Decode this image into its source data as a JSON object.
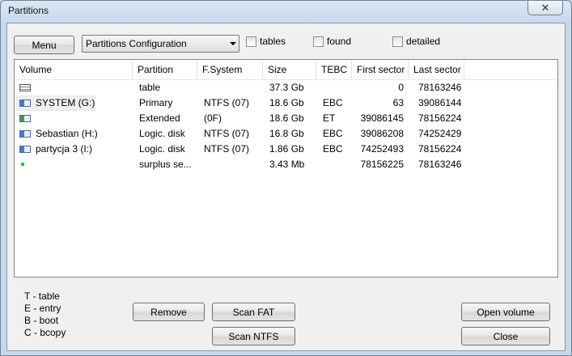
{
  "window": {
    "title": "Partitions",
    "close_glyph": "✕"
  },
  "toolbar": {
    "menu_label": "Menu",
    "view_select": "Partitions Configuration",
    "checkboxes": [
      {
        "label": "tables",
        "checked": false
      },
      {
        "label": "found",
        "checked": false
      },
      {
        "label": "detailed",
        "checked": false
      }
    ]
  },
  "table": {
    "columns": [
      "Volume",
      "Partition",
      "F.System",
      "Size",
      "TEBC",
      "First sector",
      "Last sector"
    ],
    "rows": [
      {
        "icon": "table-icon",
        "volume": "",
        "partition": "table",
        "fs": "",
        "size": "37.3 Gb",
        "tebc": "",
        "first": "0",
        "last": "78163246"
      },
      {
        "icon": "drive-blue-icon",
        "volume": "SYSTEM (G:)",
        "partition": "Primary",
        "fs": "NTFS (07)",
        "size": "18.6 Gb",
        "tebc": "EBC",
        "first": "63",
        "last": "39086144"
      },
      {
        "icon": "drive-green-icon",
        "volume": "",
        "partition": "Extended",
        "fs": "(0F)",
        "size": "18.6 Gb",
        "tebc": "ET",
        "first": "39086145",
        "last": "78156224"
      },
      {
        "icon": "drive-blue-icon",
        "volume": "Sebastian (H:)",
        "partition": "Logic. disk",
        "fs": "NTFS (07)",
        "size": "16.8 Gb",
        "tebc": "EBC",
        "first": "39086208",
        "last": "74252429"
      },
      {
        "icon": "drive-blue-icon",
        "volume": "partycja 3 (I:)",
        "partition": "Logic. disk",
        "fs": "NTFS (07)",
        "size": "1.86 Gb",
        "tebc": "EBC",
        "first": "74252493",
        "last": "78156224"
      },
      {
        "icon": "free-space-icon",
        "volume": "",
        "partition": "surplus se...",
        "fs": "",
        "size": "3.43 Mb",
        "tebc": "",
        "first": "78156225",
        "last": "78163246"
      }
    ]
  },
  "legend": [
    "T - table",
    "E - entry",
    "B - boot",
    "C - bcopy"
  ],
  "buttons": {
    "remove": "Remove",
    "scan_fat": "Scan FAT",
    "scan_ntfs": "Scan NTFS",
    "open_volume": "Open volume",
    "close": "Close"
  }
}
